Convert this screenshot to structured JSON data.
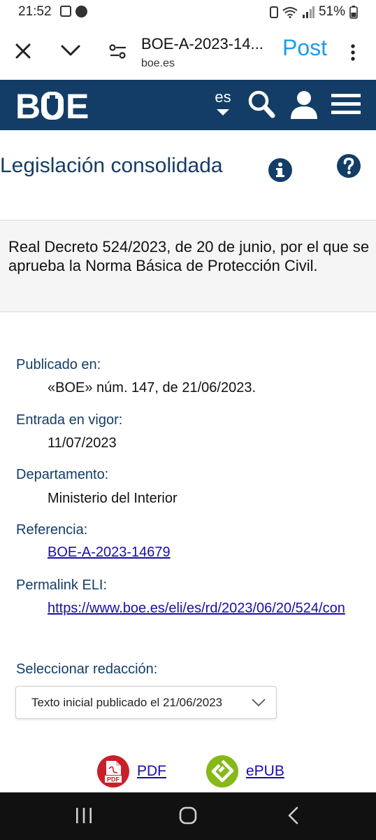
{
  "status_bar": {
    "time": "21:52",
    "battery": "51%"
  },
  "browser": {
    "tab_title": "BOE-A-2023-14...",
    "domain": "boe.es",
    "post_label": "Post",
    "accent": "#1d9bf0"
  },
  "boe_header": {
    "logo_text": "BOE",
    "lang": "es",
    "bg": "#133d66"
  },
  "page": {
    "title": "Legislación consolidada",
    "law_title": "Real Decreto 524/2023, de 20 de junio, por el que se aprueba la Norma Básica de Protección Civil."
  },
  "meta": {
    "publicado_label": "Publicado en:",
    "publicado_value": "«BOE» núm. 147, de 21/06/2023.",
    "vigor_label": "Entrada en vigor:",
    "vigor_value": "11/07/2023",
    "departamento_label": "Departamento:",
    "departamento_value": "Ministerio del Interior",
    "referencia_label": "Referencia:",
    "referencia_value": "BOE-A-2023-14679",
    "eli_label": "Permalink ELI:",
    "eli_value": "https://www.boe.es/eli/es/rd/2023/06/20/524/con"
  },
  "redaccion": {
    "label": "Seleccionar redacción:",
    "selected": "Texto inicial publicado el 21/06/2023"
  },
  "downloads": {
    "pdf_label": "PDF",
    "pdf_badge": "PDF",
    "epub_label": "ePUB"
  }
}
